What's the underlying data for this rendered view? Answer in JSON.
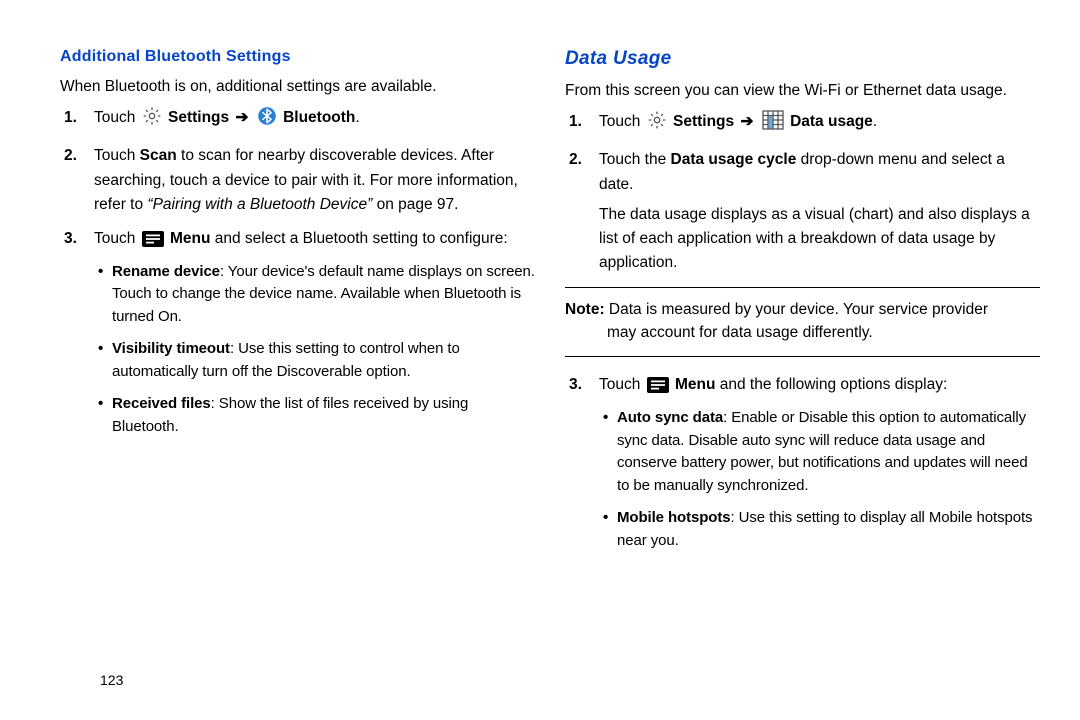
{
  "left": {
    "heading": "Additional Bluetooth Settings",
    "intro": "When Bluetooth is on, additional settings are available.",
    "step1_touch": "Touch ",
    "step1_settings": "Settings",
    "step1_arrow": "➔",
    "step1_bluetooth": "Bluetooth",
    "step1_period": ".",
    "step2_a": "Touch ",
    "step2_scan": "Scan",
    "step2_b": " to scan for nearby discoverable devices. After searching, touch a device to pair with it. For more information, refer to ",
    "step2_ref": "“Pairing with a Bluetooth Device”",
    "step2_c": " on page 97.",
    "step3_a": "Touch ",
    "step3_menu": "Menu",
    "step3_b": " and select a Bluetooth setting to configure:",
    "bullets": {
      "b1_label": "Rename device",
      "b1_text": ": Your device's default name displays on screen. Touch to change the device name. Available when Bluetooth is turned On.",
      "b2_label": "Visibility timeout",
      "b2_text": ": Use this setting to control when to automatically turn off the Discoverable option.",
      "b3_label": "Received files",
      "b3_text": ": Show the list of files received by using Bluetooth."
    }
  },
  "right": {
    "heading": "Data Usage",
    "intro": "From this screen you can view the Wi-Fi or Ethernet data usage.",
    "step1_touch": "Touch ",
    "step1_settings": "Settings",
    "step1_arrow": "➔",
    "step1_datausage": "Data usage",
    "step1_period": ".",
    "step2_a": "Touch the ",
    "step2_cycle": "Data usage cycle",
    "step2_b": " drop-down menu and select a date.",
    "step2_c": "The data usage displays as a visual (chart) and also displays a list of each application with a breakdown of data usage by application.",
    "note_label": "Note: ",
    "note_first": "Data is measured by your device. Your service provider",
    "note_rest": "may account for data usage differently.",
    "step3_a": "Touch ",
    "step3_menu": "Menu",
    "step3_b": " and the following options display:",
    "bullets": {
      "b1_label": "Auto sync data",
      "b1_text": ": Enable or Disable this option to automatically sync data. Disable auto sync will reduce data usage and conserve battery power, but notifications and updates will need to be manually synchronized.",
      "b2_label": "Mobile hotspots",
      "b2_text": ": Use this setting to display all Mobile hotspots near you."
    }
  },
  "page_number": "123"
}
